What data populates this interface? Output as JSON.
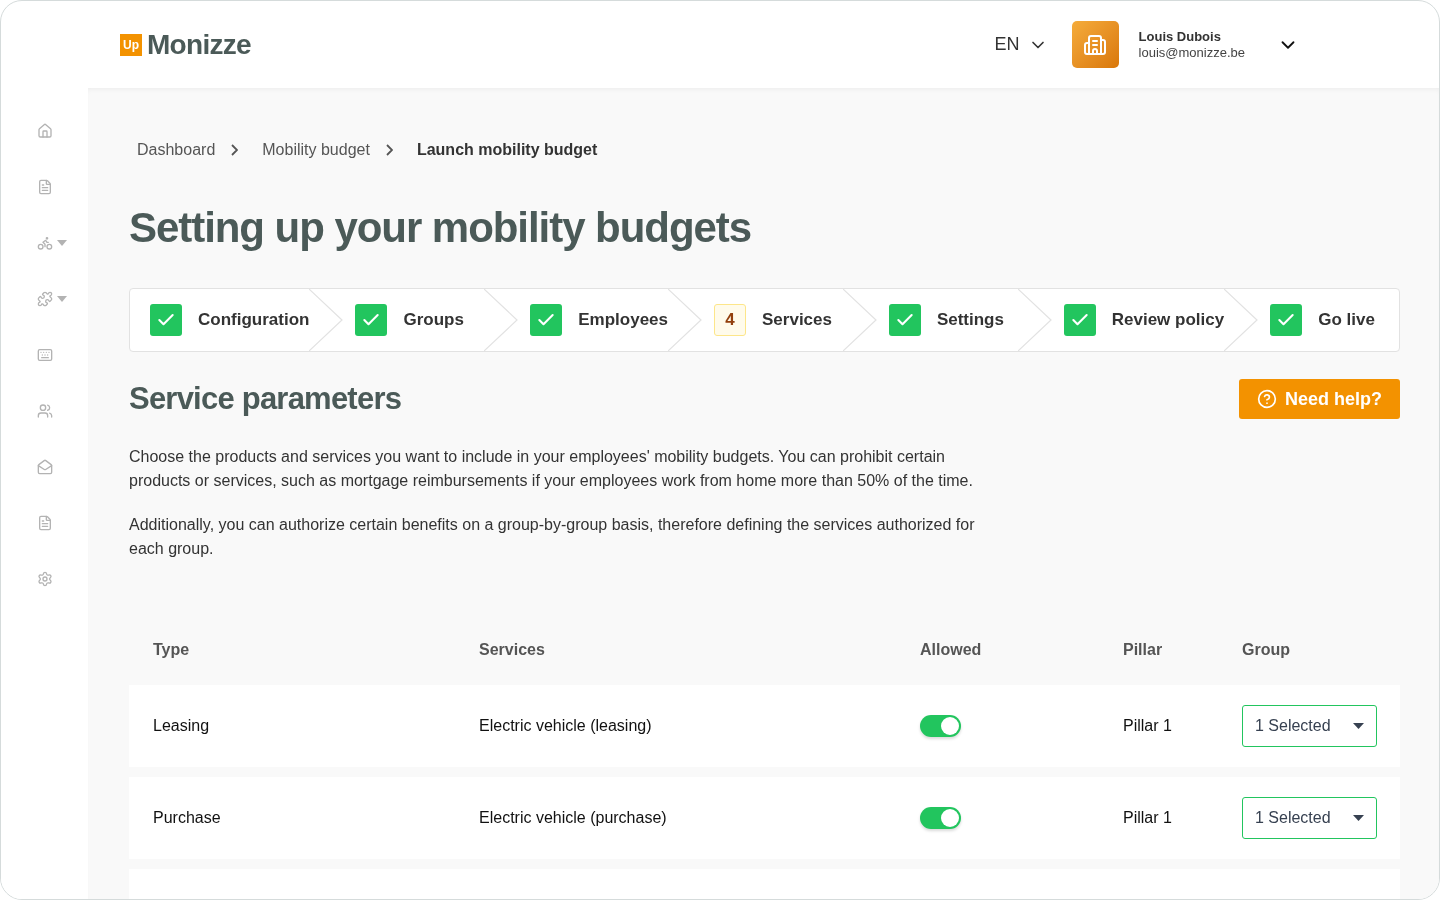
{
  "header": {
    "logo_badge": "Up",
    "logo_text": "Monizze",
    "language": "EN",
    "user": {
      "name": "Louis Dubois",
      "email": "louis@monizze.be"
    }
  },
  "sidebar": {
    "items": [
      {
        "kind": "home",
        "submenu": false
      },
      {
        "kind": "document",
        "submenu": false
      },
      {
        "kind": "bike",
        "submenu": true
      },
      {
        "kind": "puzzle",
        "submenu": true
      },
      {
        "kind": "keyboard",
        "submenu": false
      },
      {
        "kind": "users",
        "submenu": false
      },
      {
        "kind": "money",
        "submenu": false
      },
      {
        "kind": "document",
        "submenu": false
      },
      {
        "kind": "settings",
        "submenu": false
      }
    ]
  },
  "breadcrumb": [
    {
      "label": "Dashboard",
      "current": false
    },
    {
      "label": "Mobility budget",
      "current": false
    },
    {
      "label": "Launch mobility budget",
      "current": true
    }
  ],
  "title": "Setting up your mobility budgets",
  "steps": [
    {
      "label": "Configuration",
      "done": true
    },
    {
      "label": "Groups",
      "done": true
    },
    {
      "label": "Employees",
      "done": true
    },
    {
      "label": "Services",
      "done": false,
      "number": "4"
    },
    {
      "label": "Settings",
      "done": true
    },
    {
      "label": "Review policy",
      "done": true
    },
    {
      "label": "Go live",
      "done": true
    }
  ],
  "section_title": "Service parameters",
  "help_button": "Need help?",
  "paragraphs": [
    "Choose the products and services you want to include in your employees' mobility budgets. You can prohibit certain products or services, such as mortgage reimbursements if your employees work from home more than 50% of the time.",
    "Additionally, you can authorize certain benefits on a group-by-group basis, therefore defining the services authorized for each group."
  ],
  "table": {
    "columns": [
      "Type",
      "Services",
      "Allowed",
      "Pillar",
      "Group"
    ],
    "rows": [
      {
        "type": "Leasing",
        "service": "Electric vehicle (leasing)",
        "allowed": true,
        "pillar": "Pillar 1",
        "group": "1 Selected"
      },
      {
        "type": "Purchase",
        "service": "Electric vehicle (purchase)",
        "allowed": true,
        "pillar": "Pillar 1",
        "group": "1 Selected"
      }
    ]
  }
}
